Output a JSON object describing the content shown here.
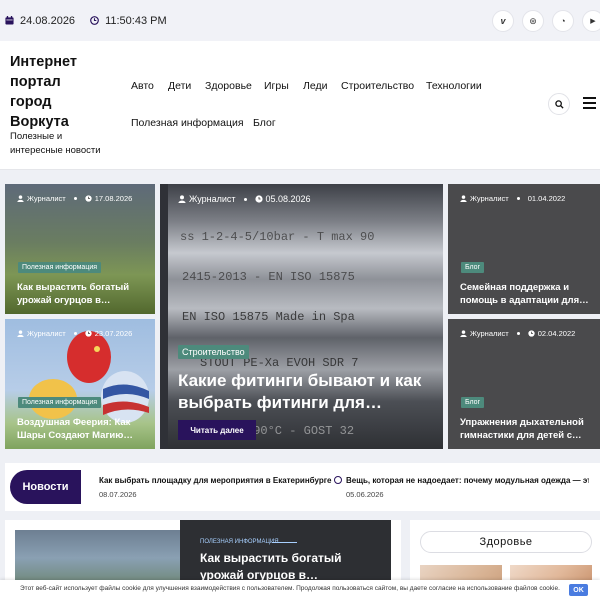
{
  "topbar": {
    "date": "24.08.2026",
    "time": "11:50:43 PM",
    "social": [
      {
        "icon": "vimeo-icon",
        "glyph": "v"
      },
      {
        "icon": "dribbble-icon",
        "glyph": "⊛"
      },
      {
        "icon": "whatsapp-icon",
        "glyph": "◔"
      },
      {
        "icon": "youtube-icon",
        "glyph": "▶"
      }
    ]
  },
  "header": {
    "site_title": "Интернет портал город Воркута",
    "site_desc": "Полезные и интересные новости",
    "nav": [
      "Авто",
      "Дети",
      "Здоровье",
      "Игры",
      "Леди",
      "Строительство",
      "Технологии",
      "Полезная информация",
      "Блог"
    ]
  },
  "hero": {
    "cards": [
      {
        "author": "Журналист",
        "date": "17.08.2026",
        "tag": "Полезная информация",
        "title": "Как вырастить богатый урожай огурцов в…"
      },
      {
        "author": "Журналист",
        "date": "23.07.2026",
        "tag": "Полезная информация",
        "title": "Воздушная Феерия: Как Шары Создают Магию…"
      },
      {
        "author": "Журналист",
        "date": "05.08.2026",
        "tag": "Строительство",
        "title": "Какие фитинги бывают и как выбрать фитинги для…",
        "read_more": "Читать далее"
      },
      {
        "author": "Журналист",
        "date": "01.04.2022",
        "tag": "Блог",
        "title": "Семейная поддержка и помощь в адаптации для…"
      },
      {
        "author": "Журналист",
        "date": "02.04.2022",
        "tag": "Блог",
        "title": "Упражнения дыхательной гимнастики для детей с…"
      }
    ]
  },
  "ticker": {
    "label": "Новости",
    "items": [
      {
        "title": "Как выбрать площадку для мероприятия в Екатеринбурге",
        "date": "08.07.2026"
      },
      {
        "title": "Вещь, которая не надоедает: почему модульная одежда — эт",
        "date": "05.06.2026"
      }
    ]
  },
  "feature": {
    "category": "ПОЛЕЗНАЯ ИНФОРМАЦИЯ",
    "title": "Как вырастить богатый урожай огурцов в…"
  },
  "sidebar": {
    "health_label": "Здоровье"
  },
  "cookie": {
    "text": "Этот веб-сайт использует файлы cookie для улучшения взаимодействия с пользователем. Продолжая пользоваться сайтом, вы даете согласие на использование файлов cookie.",
    "ok": "OK"
  }
}
